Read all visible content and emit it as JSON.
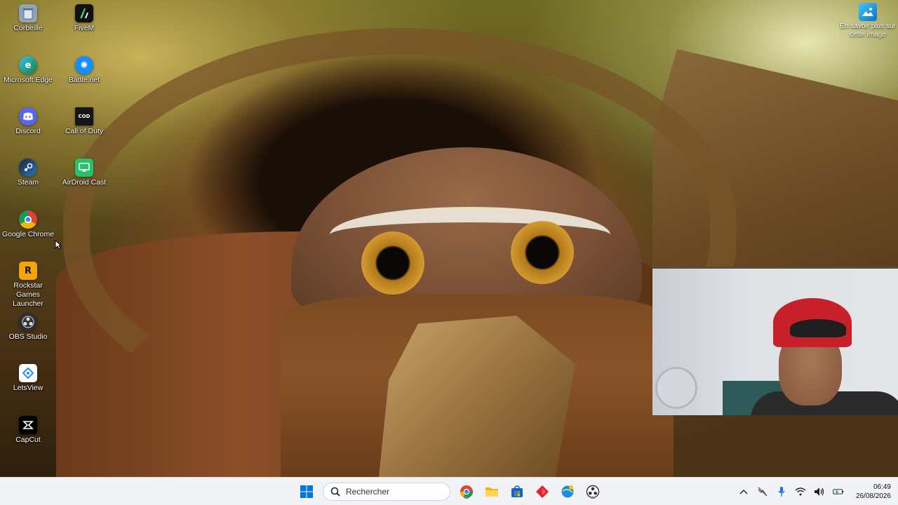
{
  "desktop": {
    "icons": [
      {
        "label": "Corbeille",
        "icon": "recycle-bin-icon",
        "color": "#8fa3b8"
      },
      {
        "label": "FiveM",
        "icon": "fivem-icon",
        "color": "#111111"
      },
      {
        "label": "Microsoft Edge",
        "icon": "edge-icon",
        "color": "#1fa2d8"
      },
      {
        "label": "Battle.net",
        "icon": "battlenet-icon",
        "color": "#148eff"
      },
      {
        "label": "Discord",
        "icon": "discord-icon",
        "color": "#5865f2"
      },
      {
        "label": "Call of Duty",
        "icon": "call-of-duty-icon",
        "color": "#151515"
      },
      {
        "label": "Steam",
        "icon": "steam-icon",
        "color": "#1b2838"
      },
      {
        "label": "AirDroid Cast",
        "icon": "airdroid-cast-icon",
        "color": "#27c06b"
      },
      {
        "label": "Google Chrome",
        "icon": "chrome-icon",
        "color": "#db4437"
      },
      {
        "label": "Rockstar Games Launcher",
        "icon": "rockstar-icon",
        "color": "#f5a400"
      },
      {
        "label": "OBS Studio",
        "icon": "obs-icon",
        "color": "#302e31"
      },
      {
        "label": "LetsView",
        "icon": "letsview-icon",
        "color": "#2a8cf0"
      },
      {
        "label": "CapCut",
        "icon": "capcut-icon",
        "color": "#000000"
      }
    ],
    "info_corner": {
      "label": "En savoir plus sur cette image",
      "icon": "learn-about-image-icon"
    }
  },
  "taskbar": {
    "search_placeholder": "Rechercher",
    "apps": [
      {
        "name": "Start",
        "icon": "windows-start-icon",
        "color": "#0078d4"
      },
      {
        "name": "Google Chrome",
        "icon": "chrome-icon",
        "color": "#db4437"
      },
      {
        "name": "File Explorer",
        "icon": "folder-icon",
        "color": "#f4b400"
      },
      {
        "name": "Microsoft Store",
        "icon": "store-icon",
        "color": "#0a66d6"
      },
      {
        "name": "App",
        "icon": "red-diamond-app-icon",
        "color": "#e8202a"
      },
      {
        "name": "Browser",
        "icon": "globe-app-icon",
        "color": "#1e88e5"
      },
      {
        "name": "OBS Studio",
        "icon": "obs-icon",
        "color": "#302e31"
      }
    ],
    "tray": {
      "icons": [
        "chevron-up-icon",
        "network-off-icon",
        "microphone-icon",
        "wifi-icon",
        "volume-icon",
        "battery-icon"
      ],
      "time": "06:49",
      "date": "26/08/2026"
    }
  }
}
